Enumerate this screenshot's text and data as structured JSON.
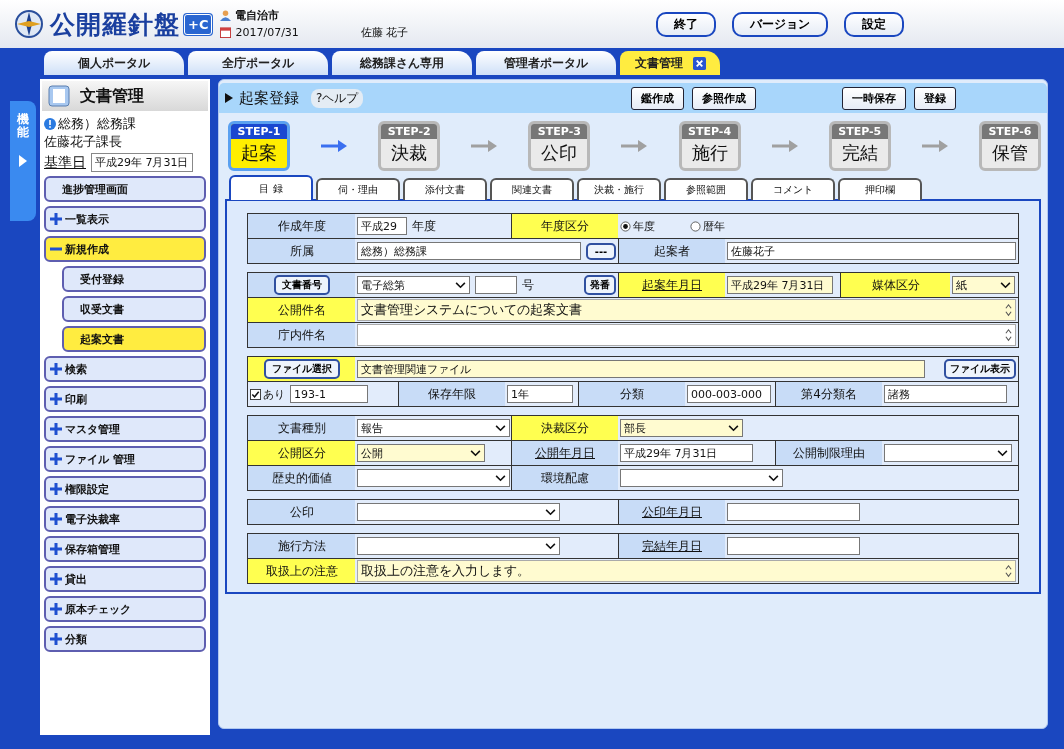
{
  "header": {
    "logo_text": "公開羅針盤",
    "logo_badge": "+C",
    "org": "電自治市",
    "date": "2017/07/31",
    "user": "佐藤 花子",
    "buttons": [
      "終了",
      "バージョン",
      "設定"
    ]
  },
  "tabs": [
    {
      "label": "個人ポータル",
      "selected": false,
      "closable": false
    },
    {
      "label": "全庁ポータル",
      "selected": false,
      "closable": false
    },
    {
      "label": "総務課さん専用",
      "selected": false,
      "closable": false
    },
    {
      "label": "管理者ポータル",
      "selected": false,
      "closable": false
    },
    {
      "label": "文書管理",
      "selected": true,
      "closable": true
    }
  ],
  "side_tab": "機能",
  "sidebar": {
    "title": "文書管理",
    "dept": "総務）総務課",
    "person": "佐藤花子課長",
    "base_date_label": "基準日",
    "base_date": "平成29年 7月31日",
    "items": [
      {
        "label": "進捗管理画面",
        "kind": "page",
        "selected": false
      },
      {
        "label": "一覧表示",
        "kind": "group",
        "expanded": false,
        "selected": false
      },
      {
        "label": "新規作成",
        "kind": "group",
        "expanded": true,
        "selected": true,
        "children": [
          {
            "label": "受付登録",
            "kind": "page",
            "selected": false
          },
          {
            "label": "収受文書",
            "kind": "page",
            "selected": false
          },
          {
            "label": "起案文書",
            "kind": "page",
            "selected": true
          }
        ]
      },
      {
        "label": "検索",
        "kind": "group",
        "expanded": false,
        "selected": false
      },
      {
        "label": "印刷",
        "kind": "group",
        "expanded": false,
        "selected": false
      },
      {
        "label": "マスタ管理",
        "kind": "group",
        "expanded": false,
        "selected": false
      },
      {
        "label": "ファイル 管理",
        "kind": "group",
        "expanded": false,
        "selected": false
      },
      {
        "label": "権限設定",
        "kind": "group",
        "expanded": false,
        "selected": false
      },
      {
        "label": "電子決裁率",
        "kind": "group",
        "expanded": false,
        "selected": false
      },
      {
        "label": "保存箱管理",
        "kind": "group",
        "expanded": false,
        "selected": false
      },
      {
        "label": "貸出",
        "kind": "group",
        "expanded": false,
        "selected": false
      },
      {
        "label": "原本チェック",
        "kind": "group",
        "expanded": false,
        "selected": false
      },
      {
        "label": "分類",
        "kind": "group",
        "expanded": false,
        "selected": false
      }
    ]
  },
  "main": {
    "title": "起案登録",
    "help": "?ヘルプ",
    "buttons": [
      "鑑作成",
      "参照作成"
    ],
    "save_buttons": [
      "一時保存",
      "登録"
    ]
  },
  "steps": [
    {
      "step": "STEP-1",
      "name": "起案",
      "selected": true
    },
    {
      "step": "STEP-2",
      "name": "決裁",
      "selected": false
    },
    {
      "step": "STEP-3",
      "name": "公印",
      "selected": false
    },
    {
      "step": "STEP-4",
      "name": "施行",
      "selected": false
    },
    {
      "step": "STEP-5",
      "name": "完結",
      "selected": false
    },
    {
      "step": "STEP-6",
      "name": "保管",
      "selected": false
    }
  ],
  "form_tabs": [
    {
      "label": "目 録",
      "selected": true
    },
    {
      "label": "伺・理由",
      "selected": false
    },
    {
      "label": "添付文書",
      "selected": false
    },
    {
      "label": "関連文書",
      "selected": false
    },
    {
      "label": "決裁・施行",
      "selected": false
    },
    {
      "label": "参照範囲",
      "selected": false
    },
    {
      "label": "コメント",
      "selected": false
    },
    {
      "label": "押印欄",
      "selected": false
    }
  ],
  "form": [
    {
      "rows": [
        {
          "fields": [
            {
              "kind": "label",
              "label": "作成年度",
              "highlight": false,
              "underline": false,
              "controls": [
                {
                  "kind": "input",
                  "value": "平成29",
                  "highlight": false
                },
                {
                  "kind": "text",
                  "text": "年度"
                }
              ]
            },
            {
              "kind": "label",
              "label": "年度区分",
              "highlight": true,
              "underline": false,
              "controls": [
                {
                  "kind": "radio",
                  "label": "年度",
                  "selected": true
                },
                {
                  "kind": "radio",
                  "label": "暦年",
                  "selected": false
                }
              ]
            }
          ]
        },
        {
          "fields": [
            {
              "kind": "label",
              "label": "所属",
              "highlight": false,
              "underline": false,
              "controls": [
                {
                  "kind": "input",
                  "value": "総務）総務課",
                  "highlight": false
                },
                {
                  "kind": "button",
                  "label": "---"
                }
              ]
            },
            {
              "kind": "label",
              "label": "起案者",
              "highlight": false,
              "underline": false,
              "controls": [
                {
                  "kind": "input",
                  "value": "佐藤花子",
                  "highlight": false
                }
              ]
            }
          ]
        }
      ]
    },
    {
      "rows": [
        {
          "fields": [
            {
              "kind": "button",
              "label": "文書番号",
              "highlight": false,
              "controls": [
                {
                  "kind": "select",
                  "value": "電子総第",
                  "highlight": false
                },
                {
                  "kind": "input",
                  "highlight": false
                },
                {
                  "kind": "text",
                  "text": "号"
                },
                {
                  "kind": "button",
                  "label": "発番"
                }
              ]
            },
            {
              "kind": "label",
              "label": "起案年月日",
              "highlight": true,
              "underline": true,
              "controls": [
                {
                  "kind": "input",
                  "value": "平成29年 7月31日",
                  "highlight": true
                }
              ]
            },
            {
              "kind": "label",
              "label": "媒体区分",
              "highlight": true,
              "underline": false,
              "controls": [
                {
                  "kind": "select",
                  "value": "紙",
                  "highlight": true
                }
              ]
            }
          ]
        },
        {
          "fields": [
            {
              "kind": "label",
              "label": "公開件名",
              "highlight": true,
              "underline": false,
              "controls": [
                {
                  "kind": "textarea",
                  "value": "文書管理システムについての起案文書",
                  "highlight": true
                }
              ]
            }
          ]
        },
        {
          "fields": [
            {
              "kind": "label",
              "label": "庁内件名",
              "highlight": false,
              "underline": false,
              "controls": [
                {
                  "kind": "textarea",
                  "highlight": false
                }
              ]
            }
          ]
        }
      ]
    },
    {
      "rows": [
        {
          "fields": [
            {
              "kind": "button",
              "label": "ファイル選択",
              "highlight": true,
              "controls": [
                {
                  "kind": "input",
                  "value": "文書管理関連ファイル",
                  "highlight": true
                },
                {
                  "kind": "button",
                  "label": "ファイル表示"
                }
              ]
            }
          ]
        },
        {
          "fields": [
            {
              "kind": "plain",
              "controls": [
                {
                  "kind": "checkbox",
                  "label": "あり",
                  "checked": true
                },
                {
                  "kind": "input",
                  "value": "193-1",
                  "highlight": false
                }
              ]
            },
            {
              "kind": "label",
              "label": "保存年限",
              "highlight": false,
              "underline": false,
              "controls": [
                {
                  "kind": "input",
                  "value": "1年",
                  "highlight": false
                }
              ]
            },
            {
              "kind": "label",
              "label": "分類",
              "highlight": false,
              "underline": false,
              "controls": [
                {
                  "kind": "input",
                  "value": "000-003-000",
                  "highlight": false
                }
              ]
            },
            {
              "kind": "label",
              "label": "第4分類名",
              "highlight": false,
              "underline": false,
              "controls": [
                {
                  "kind": "input",
                  "value": "諸務",
                  "highlight": false
                }
              ]
            }
          ]
        }
      ]
    },
    {
      "rows": [
        {
          "fields": [
            {
              "kind": "label",
              "label": "文書種別",
              "highlight": false,
              "underline": false,
              "controls": [
                {
                  "kind": "select",
                  "value": "報告",
                  "highlight": false
                }
              ]
            },
            {
              "kind": "label",
              "label": "決裁区分",
              "highlight": true,
              "underline": false,
              "controls": [
                {
                  "kind": "select",
                  "value": "部長",
                  "highlight": true
                }
              ]
            }
          ]
        },
        {
          "fields": [
            {
              "kind": "label",
              "label": "公開区分",
              "highlight": true,
              "underline": false,
              "controls": [
                {
                  "kind": "select",
                  "value": "公開",
                  "highlight": true
                }
              ]
            },
            {
              "kind": "label",
              "label": "公開年月日",
              "highlight": false,
              "underline": true,
              "controls": [
                {
                  "kind": "input",
                  "value": "平成29年 7月31日",
                  "highlight": false
                }
              ]
            },
            {
              "kind": "label",
              "label": "公開制限理由",
              "highlight": false,
              "underline": false,
              "controls": [
                {
                  "kind": "select",
                  "highlight": false
                }
              ]
            }
          ]
        },
        {
          "fields": [
            {
              "kind": "label",
              "label": "歴史的価値",
              "highlight": false,
              "underline": false,
              "controls": [
                {
                  "kind": "select",
                  "highlight": false
                }
              ]
            },
            {
              "kind": "label",
              "label": "環境配慮",
              "highlight": false,
              "underline": false,
              "controls": [
                {
                  "kind": "select",
                  "highlight": false
                }
              ]
            }
          ]
        }
      ]
    },
    {
      "rows": [
        {
          "fields": [
            {
              "kind": "label",
              "label": "公印",
              "highlight": false,
              "underline": false,
              "controls": [
                {
                  "kind": "select",
                  "highlight": false
                }
              ]
            },
            {
              "kind": "label",
              "label": "公印年月日",
              "highlight": false,
              "underline": true,
              "controls": [
                {
                  "kind": "input",
                  "highlight": false
                }
              ]
            }
          ]
        }
      ]
    },
    {
      "rows": [
        {
          "fields": [
            {
              "kind": "label",
              "label": "施行方法",
              "highlight": false,
              "underline": false,
              "controls": [
                {
                  "kind": "select",
                  "highlight": false
                }
              ]
            },
            {
              "kind": "label",
              "label": "完結年月日",
              "highlight": false,
              "underline": true,
              "controls": [
                {
                  "kind": "input",
                  "highlight": false
                }
              ]
            }
          ]
        },
        {
          "fields": [
            {
              "kind": "label",
              "label": "取扱上の注意",
              "highlight": true,
              "underline": false,
              "controls": [
                {
                  "kind": "textarea",
                  "value": "取扱上の注意を入力します。",
                  "highlight": true
                }
              ]
            }
          ]
        }
      ]
    }
  ]
}
